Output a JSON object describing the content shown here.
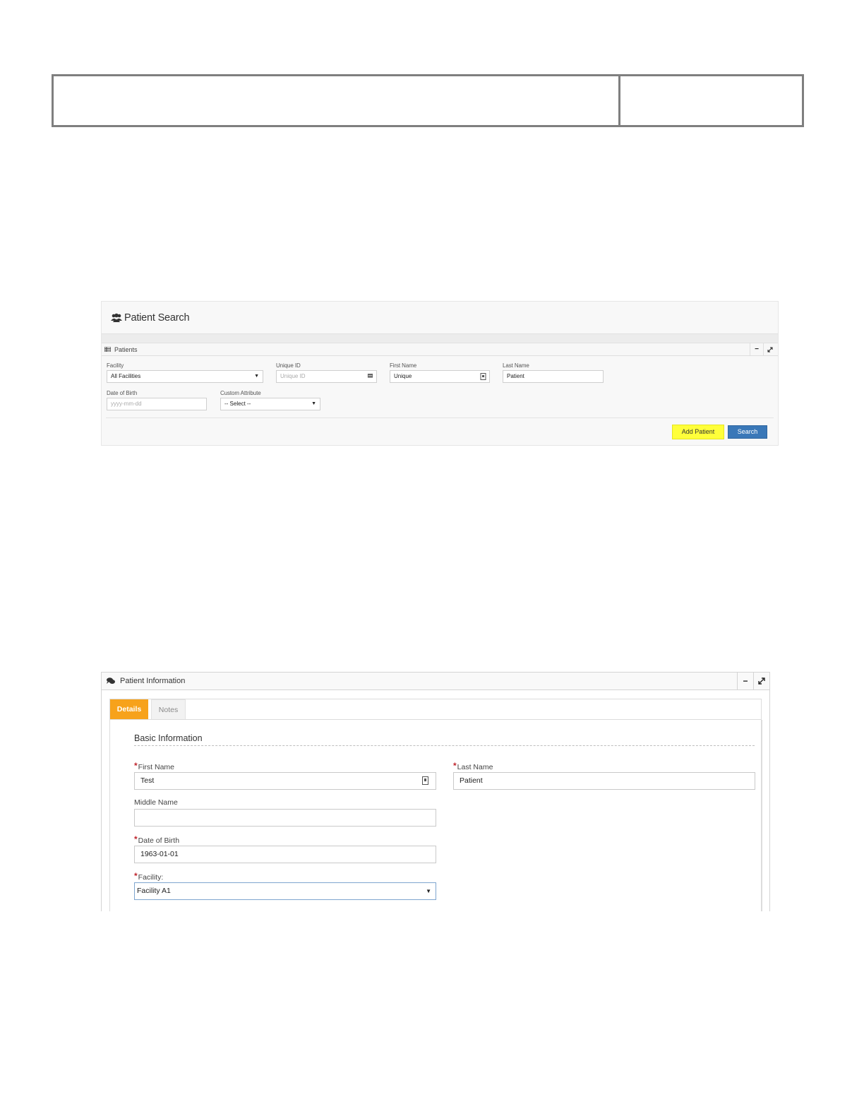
{
  "patient_search": {
    "title": "Patient Search",
    "panel_title": "Patients",
    "fields": {
      "facility": {
        "label": "Facility",
        "value": "All Facilities"
      },
      "unique_id": {
        "label": "Unique ID",
        "placeholder": "Unique ID"
      },
      "first_name": {
        "label": "First Name",
        "value": "Unique"
      },
      "last_name": {
        "label": "Last Name",
        "value": "Patient"
      },
      "date_of_birth": {
        "label": "Date of Birth",
        "placeholder": "yyyy-mm-dd"
      },
      "custom_attribute": {
        "label": "Custom Attribute",
        "value": "-- Select --"
      }
    },
    "buttons": {
      "add_patient": "Add Patient",
      "search": "Search"
    },
    "highlight_color": "#ffff3a",
    "primary_color": "#3a78b8"
  },
  "patient_information": {
    "panel_title": "Patient Information",
    "tabs": [
      {
        "label": "Details",
        "active": true
      },
      {
        "label": "Notes",
        "active": false
      }
    ],
    "section_title": "Basic Information",
    "fields": {
      "first_name": {
        "label": "First Name",
        "required": "*",
        "value": "Test"
      },
      "last_name": {
        "label": "Last Name",
        "required": "*",
        "value": "Patient"
      },
      "middle_name": {
        "label": "Middle Name",
        "value": ""
      },
      "date_of_birth": {
        "label": "Date of Birth",
        "required": "*",
        "value": "1963-01-01"
      },
      "facility": {
        "label": "Facility:",
        "required": "*",
        "value": "Facility A1"
      }
    },
    "tab_active_color": "#f7a21b",
    "required_color": "#c0262e"
  },
  "icons": {
    "minimize": "−",
    "dropdown": "▼"
  }
}
